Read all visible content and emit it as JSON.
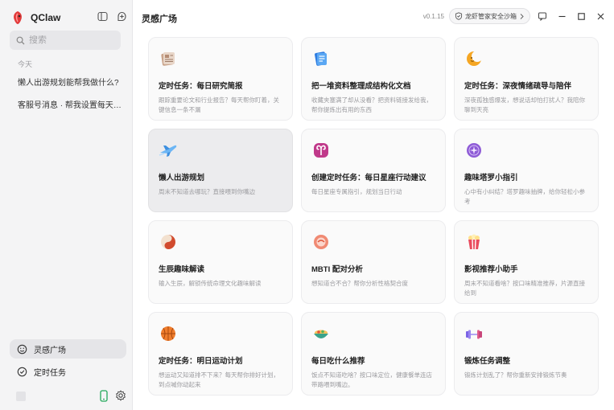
{
  "app": {
    "name": "QClaw"
  },
  "sidebar": {
    "search_placeholder": "搜索",
    "section_today": "今天",
    "history": [
      "懒人出游规划能帮我做什么?",
      "客服号消息 · 帮我设置每天早…"
    ],
    "nav": [
      {
        "label": "灵感广场",
        "active": true
      },
      {
        "label": "定时任务",
        "active": false
      }
    ]
  },
  "header": {
    "title": "灵感广场",
    "version": "v0.1.15",
    "security_label": "龙虾管家安全沙箱"
  },
  "cards": [
    {
      "title": "定时任务：每日研究简报",
      "desc": "跟踪重要论文和行业报告？每天帮你盯着，关键信息一条不漏",
      "icon": "newspaper-icon"
    },
    {
      "title": "把一堆资料整理成结构化文档",
      "desc": "收藏夹塞满了却从没看？把资料链接发给我，帮你提炼出有用的东西",
      "icon": "document-icon"
    },
    {
      "title": "定时任务：深夜情绪疏导与陪伴",
      "desc": "深夜孤独感爆发，想说话却怕打扰人？我陪你聊到天亮",
      "icon": "moon-icon"
    },
    {
      "title": "懒人出游规划",
      "desc": "周末不知道去哪玩？直接喂到你嘴边",
      "icon": "airplane-icon",
      "active": true
    },
    {
      "title": "创建定时任务：每日星座行动建议",
      "desc": "每日星座专属指引，规划当日行动",
      "icon": "aries-icon"
    },
    {
      "title": "趣味塔罗小指引",
      "desc": "心中有小纠结？塔罗趣味抽牌，给你轻松小参考",
      "icon": "tarot-icon"
    },
    {
      "title": "生辰趣味解读",
      "desc": "输入生辰，解锁传统命理文化趣味解读",
      "icon": "yin-yang-icon"
    },
    {
      "title": "MBTI 配对分析",
      "desc": "想知道合不合？帮你分析性格契合度",
      "icon": "mbti-icon"
    },
    {
      "title": "影视推荐小助手",
      "desc": "周末不知道看啥？按口味精准推荐，片源直接给到",
      "icon": "popcorn-icon"
    },
    {
      "title": "定时任务：明日运动计划",
      "desc": "想运动又知道排不下来？每天帮你排好计划，到点喊你动起来",
      "icon": "basketball-icon"
    },
    {
      "title": "每日吃什么推荐",
      "desc": "饭点不知道吃啥？按口味定位，健康餐单连店带路喂到嘴边。",
      "icon": "food-bowl-icon"
    },
    {
      "title": "锻炼任务调整",
      "desc": "锻炼计划乱了？帮你重新安排锻炼节奏",
      "icon": "dumbbell-icon"
    }
  ]
}
